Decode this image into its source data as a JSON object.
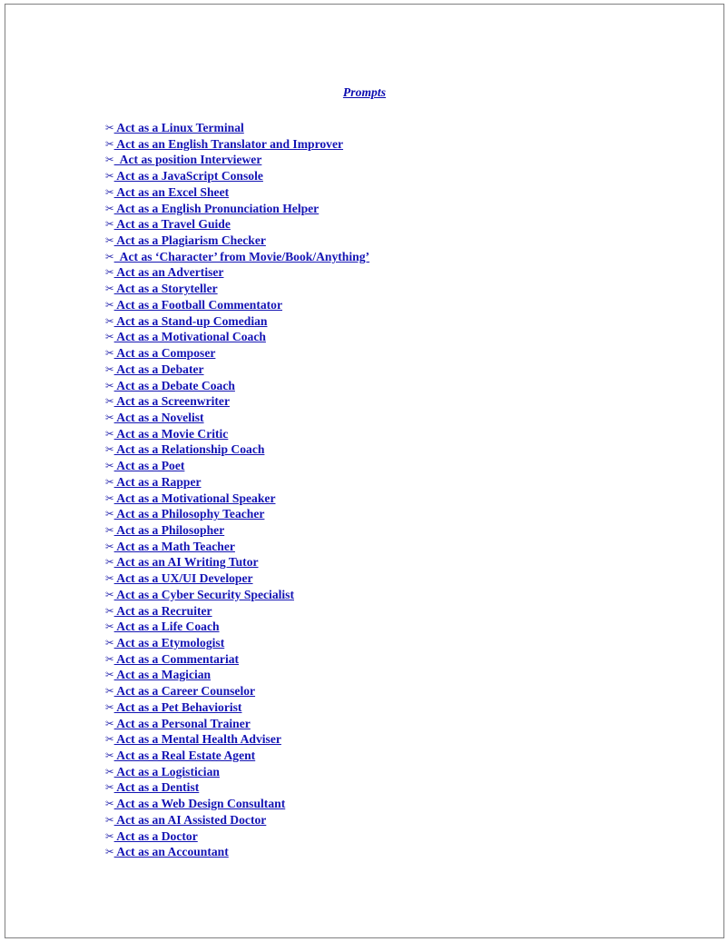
{
  "document": {
    "title": "Prompts",
    "title_icon": "none",
    "link_color": "#1414b4",
    "title_color": "#0a0aaf",
    "border_color": "#7f7f80",
    "background_color": "#ffffff",
    "bullet_icon": "scissors-icon",
    "bullet_glyph": "✂"
  },
  "prompts": [
    {
      "glyph": "✂",
      "label": " Act as a Linux Terminal"
    },
    {
      "glyph": "✂",
      "label": " Act as an English Translator and Improver"
    },
    {
      "glyph": "✂",
      "label": "  Act as position Interviewer"
    },
    {
      "glyph": "✂",
      "label": " Act as a JavaScript Console"
    },
    {
      "glyph": "✂",
      "label": " Act as an Excel Sheet"
    },
    {
      "glyph": "✂",
      "label": " Act as a English Pronunciation Helper"
    },
    {
      "glyph": "✂",
      "label": " Act as a Travel Guide"
    },
    {
      "glyph": "✂",
      "label": " Act as a Plagiarism Checker"
    },
    {
      "glyph": "✂",
      "label": "  Act as ‘Character’ from Movie/Book/Anything’"
    },
    {
      "glyph": "✂",
      "label": " Act as an Advertiser"
    },
    {
      "glyph": "✂",
      "label": " Act as a Storyteller"
    },
    {
      "glyph": "✂",
      "label": " Act as a Football Commentator"
    },
    {
      "glyph": "✂",
      "label": " Act as a Stand-up Comedian"
    },
    {
      "glyph": "✂",
      "label": " Act as a Motivational Coach"
    },
    {
      "glyph": "✂",
      "label": " Act as a Composer"
    },
    {
      "glyph": "✂",
      "label": " Act as a Debater"
    },
    {
      "glyph": "✂",
      "label": " Act as a Debate Coach"
    },
    {
      "glyph": "✂",
      "label": " Act as a Screenwriter"
    },
    {
      "glyph": "✂",
      "label": " Act as a Novelist"
    },
    {
      "glyph": "✂",
      "label": " Act as a Movie Critic"
    },
    {
      "glyph": "✂",
      "label": " Act as a Relationship Coach"
    },
    {
      "glyph": "✂",
      "label": " Act as a Poet"
    },
    {
      "glyph": "✂",
      "label": " Act as a Rapper"
    },
    {
      "glyph": "✂",
      "label": " Act as a Motivational Speaker"
    },
    {
      "glyph": "✂",
      "label": " Act as a Philosophy Teacher"
    },
    {
      "glyph": "✂",
      "label": " Act as a Philosopher"
    },
    {
      "glyph": "✂",
      "label": " Act as a Math Teacher"
    },
    {
      "glyph": "✂",
      "label": " Act as an AI Writing Tutor"
    },
    {
      "glyph": "✂",
      "label": " Act as a UX/UI Developer"
    },
    {
      "glyph": "✂",
      "label": " Act as a Cyber Security Specialist"
    },
    {
      "glyph": "✂",
      "label": " Act as a Recruiter"
    },
    {
      "glyph": "✂",
      "label": " Act as a Life Coach"
    },
    {
      "glyph": "✂",
      "label": " Act as a Etymologist"
    },
    {
      "glyph": "✂",
      "label": " Act as a Commentariat"
    },
    {
      "glyph": "✂",
      "label": " Act as a Magician"
    },
    {
      "glyph": "✂",
      "label": " Act as a Career Counselor"
    },
    {
      "glyph": "✂",
      "label": " Act as a Pet Behaviorist"
    },
    {
      "glyph": "✂",
      "label": " Act as a Personal Trainer"
    },
    {
      "glyph": "✂",
      "label": " Act as a Mental Health Adviser"
    },
    {
      "glyph": "✂",
      "label": " Act as a Real Estate Agent"
    },
    {
      "glyph": "✂",
      "label": " Act as a Logistician"
    },
    {
      "glyph": "✂",
      "label": " Act as a Dentist"
    },
    {
      "glyph": "✂",
      "label": " Act as a Web Design Consultant"
    },
    {
      "glyph": "✂",
      "label": " Act as an AI Assisted Doctor"
    },
    {
      "glyph": "✂",
      "label": " Act as a Doctor"
    },
    {
      "glyph": "✂",
      "label": " Act as an Accountant"
    }
  ]
}
